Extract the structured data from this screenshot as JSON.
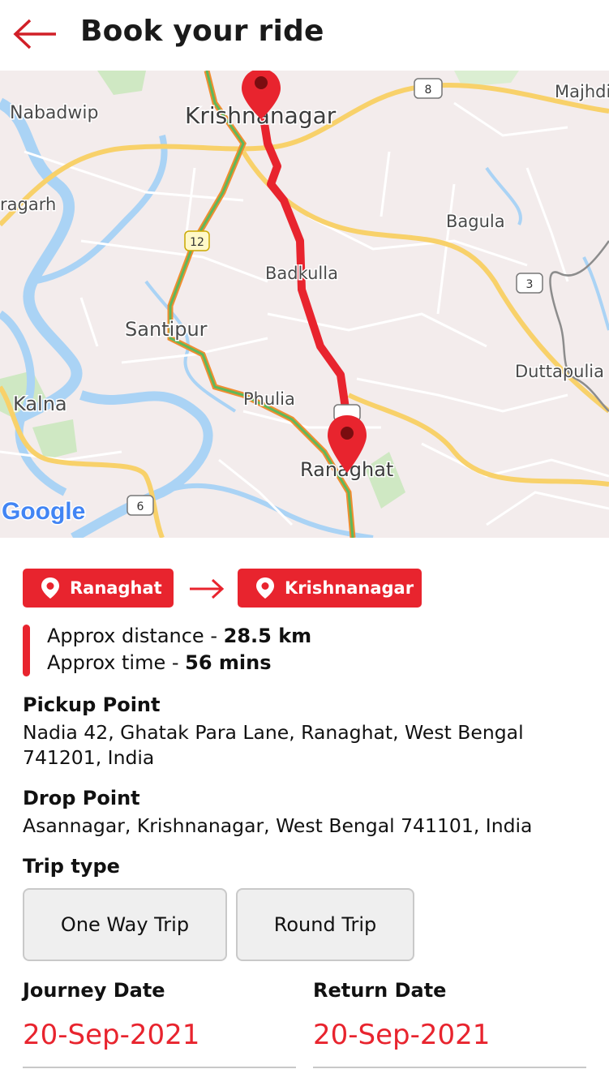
{
  "header": {
    "title": "Book your ride",
    "back_icon": "arrow-left-icon"
  },
  "map": {
    "places": [
      "Nabadwip",
      "Krishnanagar",
      "Majhdia",
      "ragarh",
      "Bagula",
      "Badkulla",
      "Santipur",
      "Duttapulia",
      "Kalna",
      "Phulia",
      "Ranaghat"
    ],
    "highways": [
      "8",
      "12",
      "3",
      "6"
    ],
    "attribution": "Google",
    "route_color": "#e8242e"
  },
  "route": {
    "from": "Ranaghat",
    "to": "Krishnanagar",
    "pin_icon": "location-pin-icon",
    "arrow_icon": "arrow-right-icon"
  },
  "info": {
    "distance_label": "Approx distance - ",
    "distance_value": "28.5 km",
    "time_label": "Approx time - ",
    "time_value": "56 mins"
  },
  "pickup": {
    "label": "Pickup Point",
    "address": "Nadia 42, Ghatak Para Lane, Ranaghat, West Bengal 741201, India"
  },
  "drop": {
    "label": "Drop Point",
    "address": "Asannagar, Krishnanagar, West Bengal 741101, India"
  },
  "trip": {
    "label": "Trip type",
    "options": [
      "One Way Trip",
      "Round Trip"
    ]
  },
  "dates": {
    "journey_label": "Journey Date",
    "journey_value": "20-Sep-2021",
    "return_label": "Return Date",
    "return_value": "20-Sep-2021"
  },
  "colors": {
    "accent": "#e8242e",
    "map_bg": "#f3ecec",
    "water": "#aad3f5",
    "road": "#f9d66a"
  }
}
